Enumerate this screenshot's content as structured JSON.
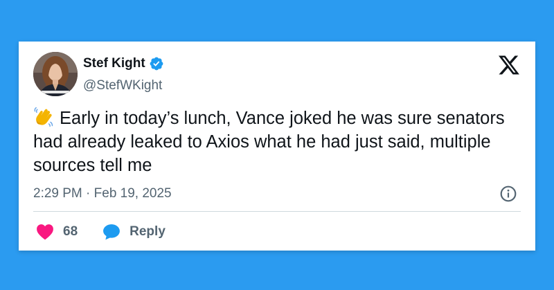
{
  "colors": {
    "background": "#2b9bf0",
    "card": "#ffffff",
    "text_primary": "#0f1419",
    "text_secondary": "#536471",
    "verified_badge": "#1d9bf0",
    "like_heart": "#f91880",
    "reply_bubble": "#1d9bf0"
  },
  "author": {
    "name": "Stef Kight",
    "handle": "@StefWKight",
    "verified": true,
    "avatar_icon": "author-photo",
    "verified_icon": "verified-badge-icon"
  },
  "platform": {
    "logo_icon": "x-logo-icon"
  },
  "tweet": {
    "emoji_icon": "waving-hand-icon",
    "text": "Early in today’s lunch, Vance joked he was sure senators had already leaked to Axios what he had just said, multiple sources tell me",
    "timestamp": "2:29 PM · Feb 19, 2025",
    "info_icon": "info-icon"
  },
  "actions": {
    "like_icon": "heart-icon",
    "like_count": "68",
    "reply_icon": "reply-bubble-icon",
    "reply_label": "Reply"
  }
}
